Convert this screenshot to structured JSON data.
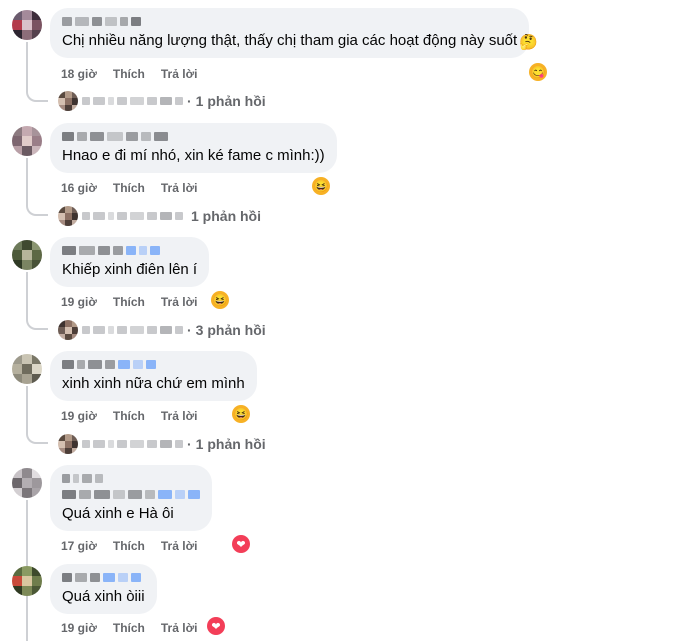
{
  "comments": [
    {
      "text": "Chị nhiều năng lượng thật, thấy chị tham gia các hoạt động này suốt",
      "time": "18 giờ",
      "like": "Thích",
      "reply": "Trả lời",
      "reaction": "🤔",
      "reply_sep": "·",
      "reply_count": "1 phản hồi"
    },
    {
      "text": "Hnao e đi mí nhó, xin ké fame c mình:))",
      "time": "16 giờ",
      "like": "Thích",
      "reply": "Trả lời",
      "reaction": "😆",
      "reply_sep": "",
      "reply_count": "1 phản hồi"
    },
    {
      "text": "Khiếp xinh điên lên í",
      "time": "19 giờ",
      "like": "Thích",
      "reply": "Trả lời",
      "reaction": "😆",
      "reply_sep": "·",
      "reply_count": "3 phản hồi"
    },
    {
      "text": "xinh xinh nữa chứ em mình",
      "time": "19 giờ",
      "like": "Thích",
      "reply": "Trả lời",
      "reaction": "😆",
      "reply_sep": "·",
      "reply_count": "1 phản hồi"
    },
    {
      "text": "Quá xinh e Hà ôi",
      "time": "17 giờ",
      "like": "Thích",
      "reply": "Trả lời",
      "reaction": "❤",
      "reaction_color": "#f33e58"
    },
    {
      "text": "Quá xinh òiii",
      "time": "19 giờ",
      "like": "Thích",
      "reply": "Trả lời",
      "reaction": "❤",
      "reaction_color": "#f33e58"
    }
  ],
  "colors": {
    "bubble": "#f0f2f5",
    "meta": "#65676b",
    "love": "#f33e58",
    "haha": "#f7b125",
    "blur_blue": "#8ab4f8"
  }
}
